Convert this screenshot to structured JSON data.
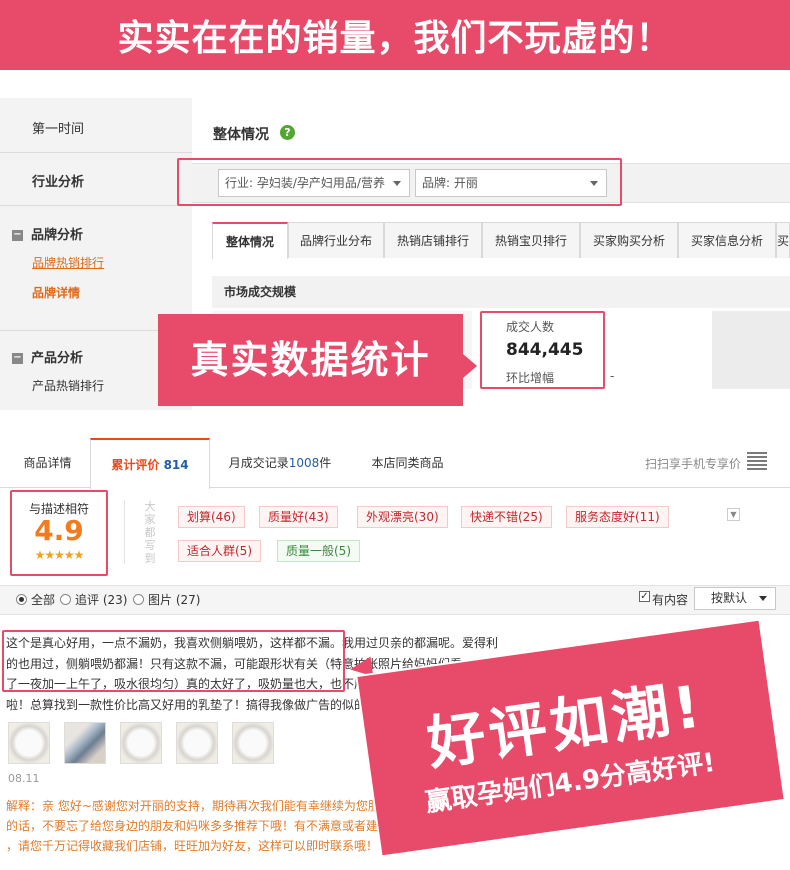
{
  "banner": {
    "text": "实实在在的销量，我们不玩虚的！"
  },
  "sidebar": {
    "items": [
      {
        "label": "第一时间"
      },
      {
        "label": "行业分析"
      },
      {
        "label": "品牌分析"
      },
      {
        "label": "品牌热销排行"
      },
      {
        "label": "品牌详情"
      },
      {
        "label": "产品分析"
      },
      {
        "label": "产品热销排行"
      }
    ]
  },
  "overview": {
    "title": "整体情况",
    "help_icon": "?",
    "industry_select": "行业: 孕妇装/孕产妇用品/营养",
    "brand_select": "品牌: 开丽",
    "tabs": [
      "整体情况",
      "品牌行业分布",
      "热销店铺排行",
      "热销宝贝排行",
      "买家购买分析",
      "买家信息分析",
      "买"
    ],
    "market_section": "市场成交规模",
    "stat_label": "成交人数",
    "stat_value": "844,445",
    "stat_sub": "环比增幅",
    "stat_dash": "-"
  },
  "callout_1": "真实数据统计",
  "product_tabs": {
    "detail": "商品详情",
    "reviews": "累计评价",
    "reviews_count": "814",
    "monthly_prefix": "月成交记录",
    "monthly_count": "1008",
    "monthly_suffix": "件",
    "similar": "本店同类商品",
    "scan": "扫扫享手机专享价"
  },
  "rating": {
    "label": "与描述相符",
    "score": "4.9",
    "stars": "★★★★★",
    "side_label": "大家都写到"
  },
  "tags": [
    {
      "text": "划算(46)",
      "tone": "positive"
    },
    {
      "text": "质量好(43)",
      "tone": "positive"
    },
    {
      "text": "外观漂亮(30)",
      "tone": "positive"
    },
    {
      "text": "快递不错(25)",
      "tone": "positive"
    },
    {
      "text": "服务态度好(11)",
      "tone": "positive"
    },
    {
      "text": "适合人群(5)",
      "tone": "positive"
    },
    {
      "text": "质量一般(5)",
      "tone": "neutral"
    }
  ],
  "filters": {
    "all": "全部",
    "followup": "追评 (23)",
    "pictures": "图片 (27)",
    "has_content": "有内容",
    "sort": "按默认"
  },
  "review": {
    "line1": "这个是真心好用，一点不漏奶，我喜欢侧躺喂奶，这样都不漏。我用过贝亲的都漏呢。爱得利",
    "line2": "的也用过，侧躺喂奶都漏！只有这款不漏，可能跟形状有关（特意拍张照片给妈妈们看，用",
    "line3": "了一夜加一上午了，吸水很均匀）真的太好了，吸奶量也大，也不厚，更亲肤。总之就是好用",
    "line4": "啦！总算找到一款性价比高又好用的乳垫了！搞得我像做广告的似的，哈哈",
    "date": "08.11",
    "reply_1": "解释：亲 您好~感谢您对开丽的支持，期待再次我们能有幸继续为您服务！如果您对产品满意",
    "reply_2": "的话，不要忘了给您身边的朋友和妈咪多多推荐下哦！有不满意或者建议请您直接与我们联系",
    "reply_3": "，请您千万记得收藏我们店铺，旺旺加为好友，这样可以即时联系哦！"
  },
  "callout_2": {
    "main": "好评如潮!",
    "sub": "赢取孕妈们4.9分高好评!"
  },
  "colors": {
    "brand_pink": "#e84a6a",
    "orange": "#e06a1a",
    "score_orange": "#f27b1e"
  }
}
